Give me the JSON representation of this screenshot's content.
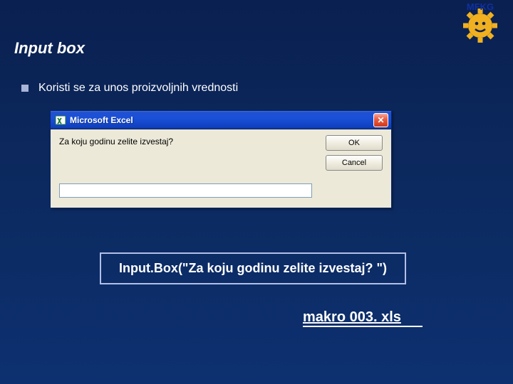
{
  "logo": {
    "text_top": "MFKG"
  },
  "title": "Input box",
  "bullet_text": "Koristi se za unos proizvoljnih vrednosti",
  "dialog": {
    "title": "Microsoft Excel",
    "prompt": "Za koju godinu zelite izvestaj?",
    "ok": "OK",
    "cancel": "Cancel",
    "input_value": ""
  },
  "code": "Input.Box(\"Za koju godinu zelite izvestaj? \")",
  "file_link": "makro 003. xls"
}
